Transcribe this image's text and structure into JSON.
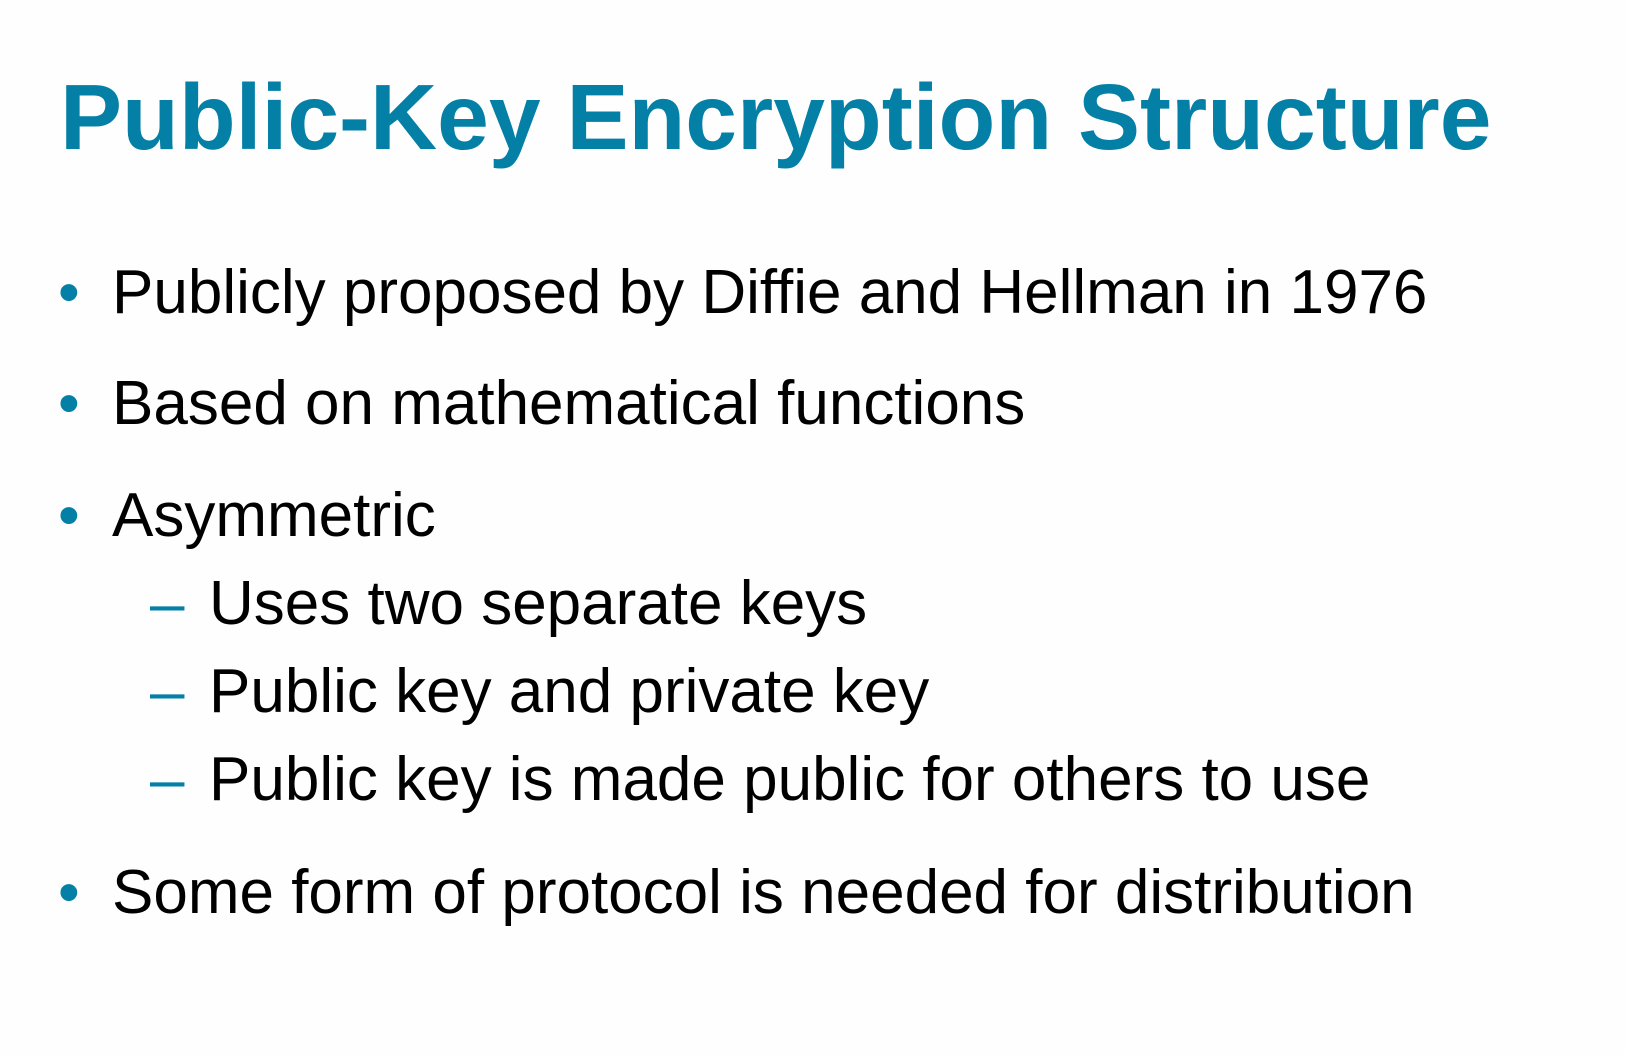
{
  "slide": {
    "title": "Public-Key Encryption Structure",
    "accent_color": "#0480a6",
    "bullets": [
      {
        "text": "Publicly proposed by Diffie and Hellman in 1976"
      },
      {
        "text": "Based on mathematical functions"
      },
      {
        "text": "Asymmetric",
        "sub": [
          {
            "text": "Uses two separate keys"
          },
          {
            "text": "Public key and private key"
          },
          {
            "text": "Public key is made public for others to use"
          }
        ]
      },
      {
        "text": "Some form of protocol is needed for distribution"
      }
    ]
  }
}
